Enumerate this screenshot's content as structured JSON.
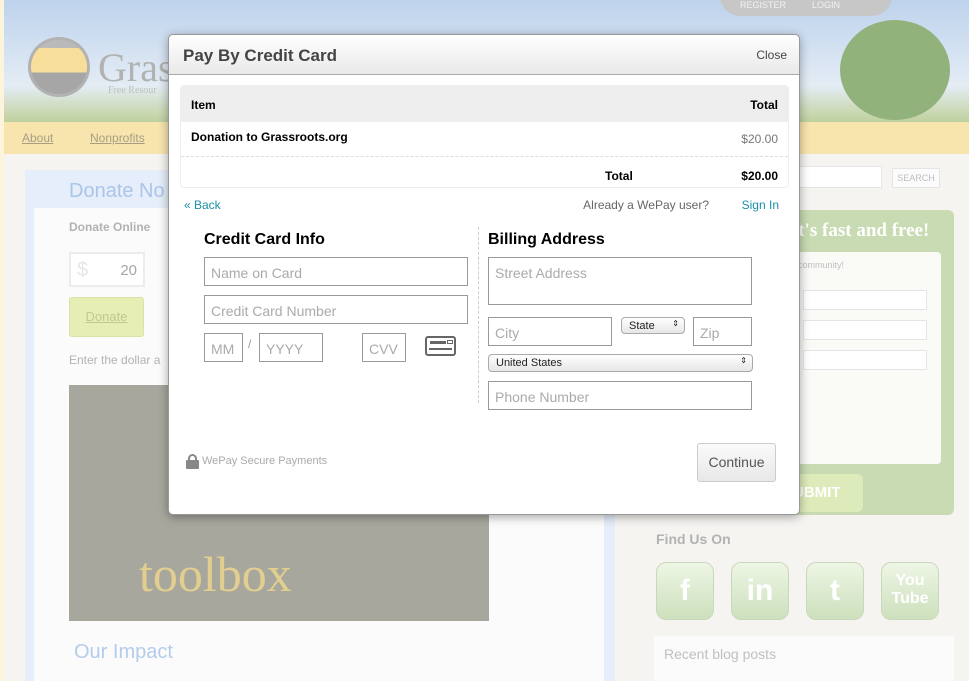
{
  "site": {
    "logo_text": "Grass",
    "tagline": "Free Resour",
    "register": "REGISTER",
    "login": "LOGIN",
    "nav": [
      "About",
      "Nonprofits"
    ],
    "search_button": "SEARCH",
    "donate_heading": "Donate No",
    "donate_online": "Donate Online",
    "currency": "$",
    "amount": "20",
    "donate_button": "Donate",
    "instruction": "Enter the dollar a",
    "our_impact": "Our Impact",
    "signup_heading": "it's fast and free!",
    "signup_text": "community!",
    "submit": "UBMIT",
    "find_us": "Find Us On",
    "social": [
      "f",
      "in",
      "t",
      "You Tube"
    ],
    "recent_posts": "Recent blog posts",
    "banner_text": "toolbox"
  },
  "modal": {
    "title": "Pay By Credit Card",
    "close": "Close",
    "table": {
      "headers": [
        "Item",
        "Total"
      ],
      "rows": [
        {
          "item": "Donation to Grassroots.org",
          "total": "$20.00"
        }
      ],
      "total_label": "Total",
      "total_value": "$20.00"
    },
    "back": "« Back",
    "already": "Already a WePay user?",
    "sign_in": "Sign In",
    "cc": {
      "heading": "Credit Card Info",
      "name_ph": "Name on Card",
      "number_ph": "Credit Card Number",
      "mm_ph": "MM",
      "sep": "/",
      "yyyy_ph": "YYYY",
      "cvv_ph": "CVV"
    },
    "billing": {
      "heading": "Billing Address",
      "street_ph": "Street Address",
      "city_ph": "City",
      "state": "State",
      "zip_ph": "Zip",
      "country": "United States",
      "phone_ph": "Phone Number"
    },
    "secure": "WePay Secure Payments",
    "continue": "Continue"
  }
}
